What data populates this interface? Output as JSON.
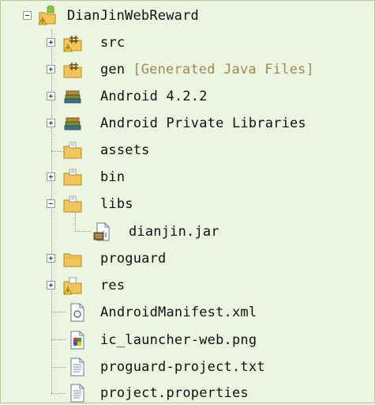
{
  "tree": {
    "root": {
      "label": "DianJinWebReward",
      "icon": "android-project-icon",
      "expanded": true
    },
    "items": [
      {
        "label": "src",
        "icon": "source-folder-icon",
        "expandable": true,
        "expanded": false,
        "warning": true
      },
      {
        "label": "gen",
        "decoration": "[Generated Java Files]",
        "icon": "source-folder-icon",
        "expandable": true,
        "expanded": false
      },
      {
        "label": "Android 4.2.2",
        "icon": "library-icon",
        "expandable": true,
        "expanded": false
      },
      {
        "label": "Android Private Libraries",
        "icon": "library-icon",
        "expandable": true,
        "expanded": false
      },
      {
        "label": "assets",
        "icon": "folder-icon",
        "expandable": false
      },
      {
        "label": "bin",
        "icon": "folder-icon",
        "expandable": true,
        "expanded": false
      },
      {
        "label": "libs",
        "icon": "folder-icon",
        "expandable": true,
        "expanded": true,
        "children": [
          {
            "label": "dianjin.jar",
            "icon": "jar-icon"
          }
        ]
      },
      {
        "label": "proguard",
        "icon": "plain-folder-icon",
        "expandable": true,
        "expanded": false
      },
      {
        "label": "res",
        "icon": "folder-icon",
        "expandable": true,
        "expanded": false,
        "warning": true
      },
      {
        "label": "AndroidManifest.xml",
        "icon": "xml-file-icon",
        "expandable": false
      },
      {
        "label": "ic_launcher-web.png",
        "icon": "image-file-icon",
        "expandable": false
      },
      {
        "label": "proguard-project.txt",
        "icon": "text-file-icon",
        "expandable": false
      },
      {
        "label": "project.properties",
        "icon": "text-file-icon",
        "expandable": false
      }
    ]
  },
  "colors": {
    "background": "#ecf5e0",
    "folder": "#f2c55a",
    "warning": "#f5c518",
    "decoration": "#9a8c5a"
  }
}
